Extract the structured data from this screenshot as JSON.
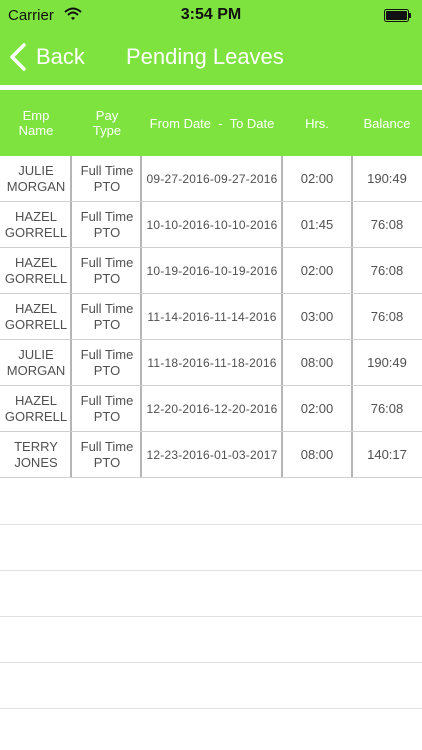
{
  "status_bar": {
    "carrier": "Carrier",
    "time": "3:54 PM"
  },
  "nav": {
    "back_label": "Back",
    "title": "Pending Leaves"
  },
  "table": {
    "headers": [
      "Emp\nName",
      "Pay\nType",
      "From Date  -  To Date",
      "Hrs.",
      "Balance"
    ],
    "rows": [
      {
        "name": "JULIE\nMORGAN",
        "pay_type": "Full Time\nPTO",
        "dates": "09-27-2016-09-27-2016",
        "hours": "02:00",
        "balance": "190:49"
      },
      {
        "name": "HAZEL\nGORRELL",
        "pay_type": "Full Time\nPTO",
        "dates": "10-10-2016-10-10-2016",
        "hours": "01:45",
        "balance": "76:08"
      },
      {
        "name": "HAZEL\nGORRELL",
        "pay_type": "Full Time\nPTO",
        "dates": "10-19-2016-10-19-2016",
        "hours": "02:00",
        "balance": "76:08"
      },
      {
        "name": "HAZEL\nGORRELL",
        "pay_type": "Full Time\nPTO",
        "dates": "11-14-2016-11-14-2016",
        "hours": "03:00",
        "balance": "76:08"
      },
      {
        "name": "JULIE\nMORGAN",
        "pay_type": "Full Time\nPTO",
        "dates": "11-18-2016-11-18-2016",
        "hours": "08:00",
        "balance": "190:49"
      },
      {
        "name": "HAZEL\nGORRELL",
        "pay_type": "Full Time\nPTO",
        "dates": "12-20-2016-12-20-2016",
        "hours": "02:00",
        "balance": "76:08"
      },
      {
        "name": "TERRY\nJONES",
        "pay_type": "Full Time\nPTO",
        "dates": "12-23-2016-01-03-2017",
        "hours": "08:00",
        "balance": "140:17"
      }
    ]
  },
  "icons": {
    "wifi": "wifi-icon",
    "battery": "battery-icon",
    "back": "chevron-left-icon"
  },
  "colors": {
    "accent": "#7ee33f",
    "header_text": "#ffffff",
    "cell_text": "#505050"
  }
}
